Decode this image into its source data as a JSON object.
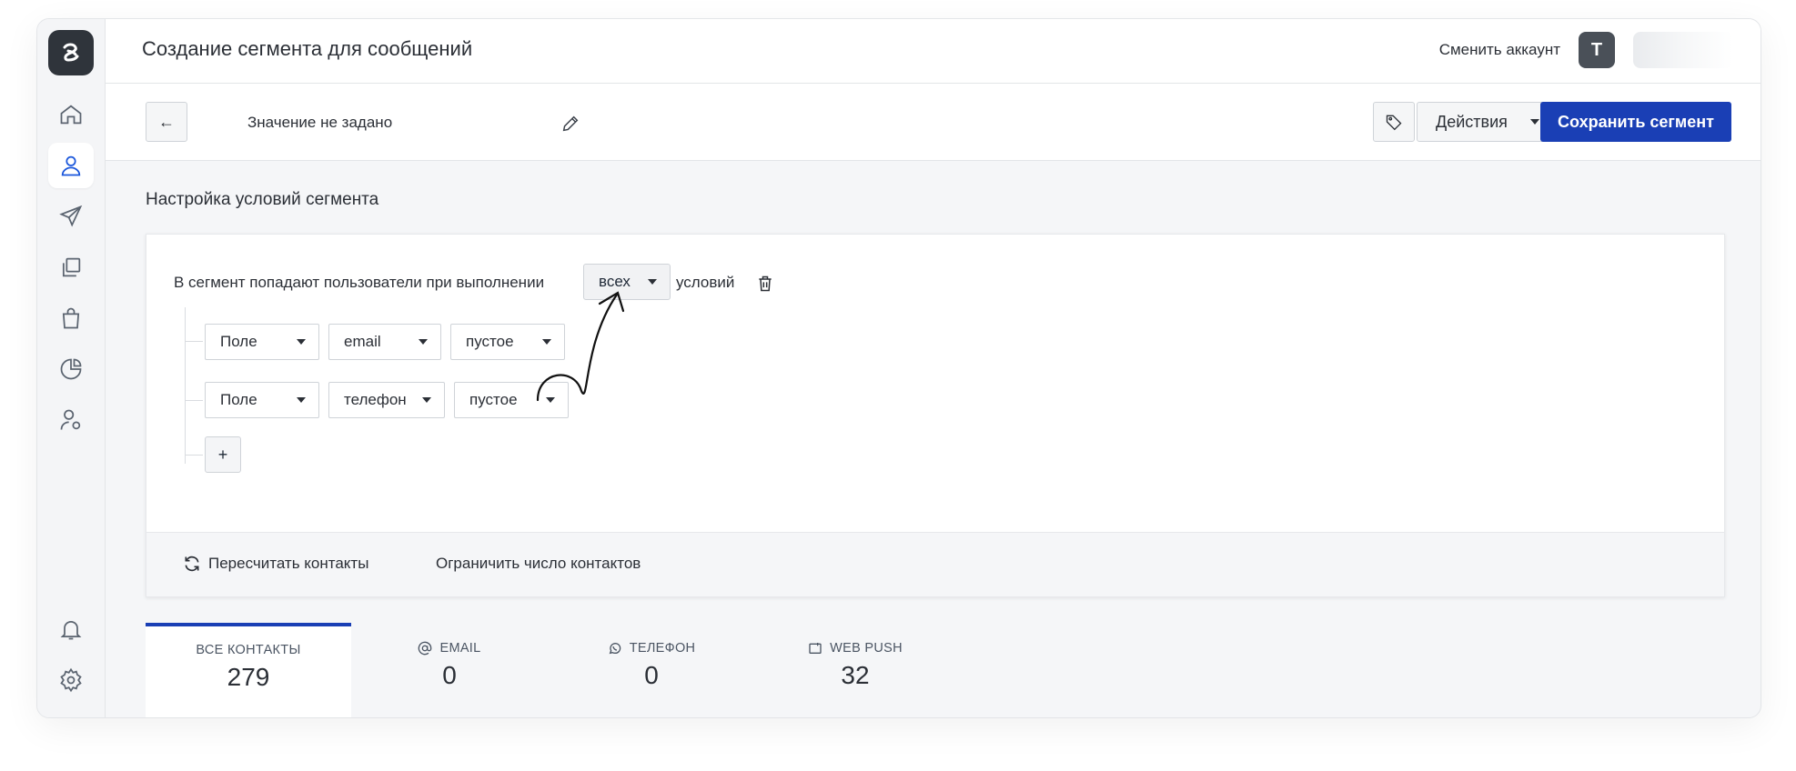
{
  "header": {
    "title": "Создание сегмента для сообщений",
    "switch_account": "Сменить аккаунт",
    "avatar_letter": "T"
  },
  "toolbar": {
    "back_label": "←",
    "segment_name": "Значение не задано",
    "actions_label": "Действия",
    "save_label": "Сохранить сегмент"
  },
  "section": {
    "title": "Настройка условий сегмента"
  },
  "rule": {
    "prefix": "В сегмент попадают пользователи при выполнении",
    "match_value": "всех",
    "suffix": "условий",
    "conditions": [
      {
        "type": "Поле",
        "field": "email",
        "operator": "пустое"
      },
      {
        "type": "Поле",
        "field": "телефон",
        "operator": "пустое"
      }
    ],
    "add_label": "+"
  },
  "footer": {
    "recalc": "Пересчитать контакты",
    "limit": "Ограничить число контактов"
  },
  "stats": [
    {
      "label": "ВСЕ КОНТАКТЫ",
      "value": "279"
    },
    {
      "label": "EMAIL",
      "value": "0"
    },
    {
      "label": "ТЕЛЕФОН",
      "value": "0"
    },
    {
      "label": "WEB PUSH",
      "value": "32"
    }
  ],
  "colors": {
    "accent": "#1a3fb5",
    "logo_bg": "#2f343b"
  }
}
